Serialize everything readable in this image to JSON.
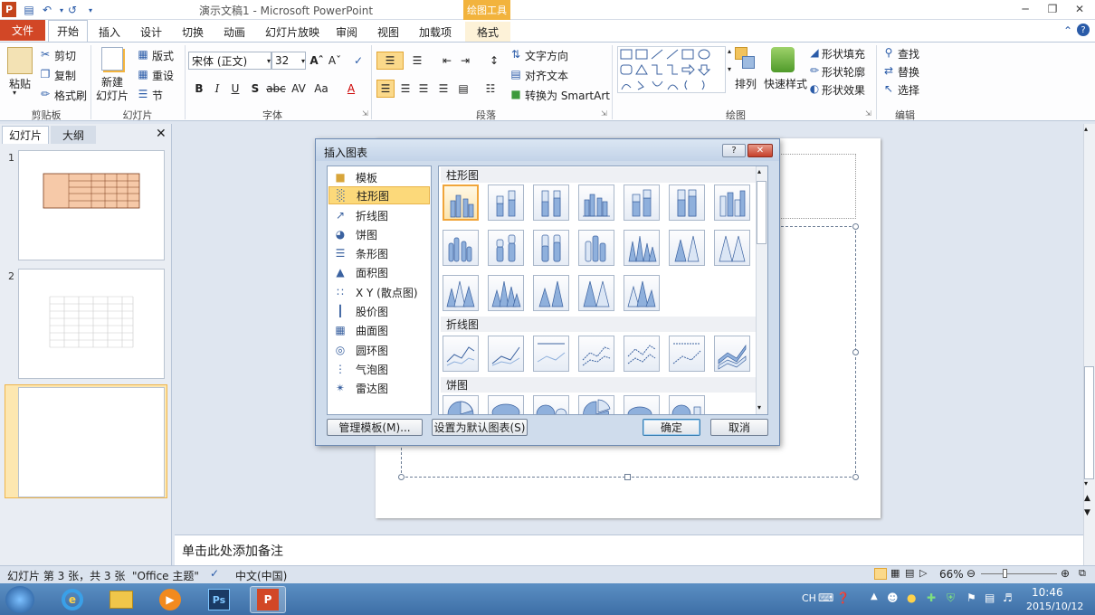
{
  "window": {
    "title": "演示文稿1 - Microsoft PowerPoint",
    "context_tab_group": "绘图工具"
  },
  "tabs": [
    {
      "label": "文件"
    },
    {
      "label": "开始"
    },
    {
      "label": "插入"
    },
    {
      "label": "设计"
    },
    {
      "label": "切换"
    },
    {
      "label": "动画"
    },
    {
      "label": "幻灯片放映"
    },
    {
      "label": "审阅"
    },
    {
      "label": "视图"
    },
    {
      "label": "加载项"
    },
    {
      "label": "格式"
    }
  ],
  "ribbon": {
    "clipboard": {
      "paste": "粘贴",
      "cut": "剪切",
      "copy": "复制",
      "format_painter": "格式刷",
      "label": "剪贴板"
    },
    "slides": {
      "new_slide": "新建",
      "new_slide2": "幻灯片",
      "layout": "版式",
      "reset": "重设",
      "section": "节",
      "label": "幻灯片"
    },
    "font": {
      "font_name": "宋体 (正文)",
      "font_size": "32",
      "label": "字体"
    },
    "paragraph": {
      "text_direction": "文字方向",
      "align_text": "对齐文本",
      "smartart": "转换为 SmartArt",
      "label": "段落"
    },
    "drawing": {
      "arrange": "排列",
      "quick_styles": "快速样式",
      "shape_fill": "形状填充",
      "shape_outline": "形状轮廓",
      "shape_effects": "形状效果",
      "label": "绘图"
    },
    "editing": {
      "find": "查找",
      "replace": "替换",
      "select": "选择",
      "label": "编辑"
    }
  },
  "panel": {
    "tab_slides": "幻灯片",
    "tab_outline": "大纲",
    "slide_numbers": [
      "1",
      "2",
      "3"
    ]
  },
  "notes": {
    "placeholder": "单击此处添加备注"
  },
  "dialog": {
    "title": "插入图表",
    "categories": [
      "模板",
      "柱形图",
      "折线图",
      "饼图",
      "条形图",
      "面积图",
      "X Y (散点图)",
      "股价图",
      "曲面图",
      "圆环图",
      "气泡图",
      "雷达图"
    ],
    "selected_category": "柱形图",
    "sections": [
      "柱形图",
      "折线图",
      "饼图"
    ],
    "manage_templates": "管理模板(M)...",
    "set_default": "设置为默认图表(S)",
    "ok": "确定",
    "cancel": "取消"
  },
  "status": {
    "slide_info": "幻灯片 第 3 张，共 3 张",
    "theme": "\"Office 主题\"",
    "language": "中文(中国)",
    "zoom": "66%"
  },
  "taskbar": {
    "ime": "CH",
    "time": "10:46",
    "date": "2015/10/12"
  }
}
